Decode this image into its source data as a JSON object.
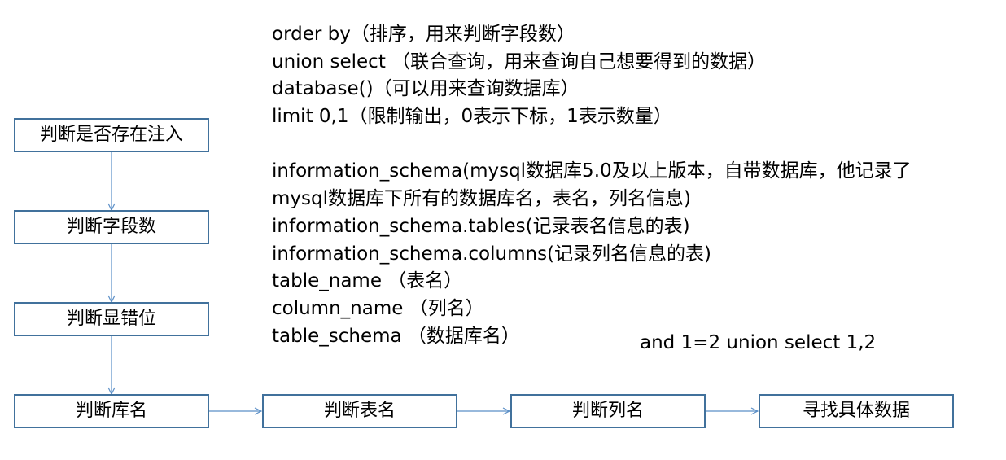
{
  "colors": {
    "box_border": "#41719c",
    "connector": "#5b8fc7",
    "text": "#000000",
    "background": "#ffffff"
  },
  "flow": {
    "vertical_steps": [
      "判断是否存在注入",
      "判断字段数",
      "判断显错位",
      "判断库名"
    ],
    "horizontal_steps": [
      "判断表名",
      "判断列名",
      "寻找具体数据"
    ]
  },
  "notes": {
    "group1": [
      "order by（排序，用来判断字段数）",
      "union select （联合查询，用来查询自己想要得到的数据）",
      "database()（可以用来查询数据库）",
      "limit 0,1（限制输出，0表示下标，1表示数量）"
    ],
    "group2": [
      "information_schema(mysql数据库5.0及以上版本，自带数据库，他记录了",
      "mysql数据库下所有的数据库名，表名，列名信息)",
      "information_schema.tables(记录表名信息的表)",
      "information_schema.columns(记录列名信息的表)",
      "table_name （表名）",
      "column_name （列名）",
      "table_schema （数据库名）"
    ]
  },
  "side_note": "and 1=2 union select 1,2"
}
